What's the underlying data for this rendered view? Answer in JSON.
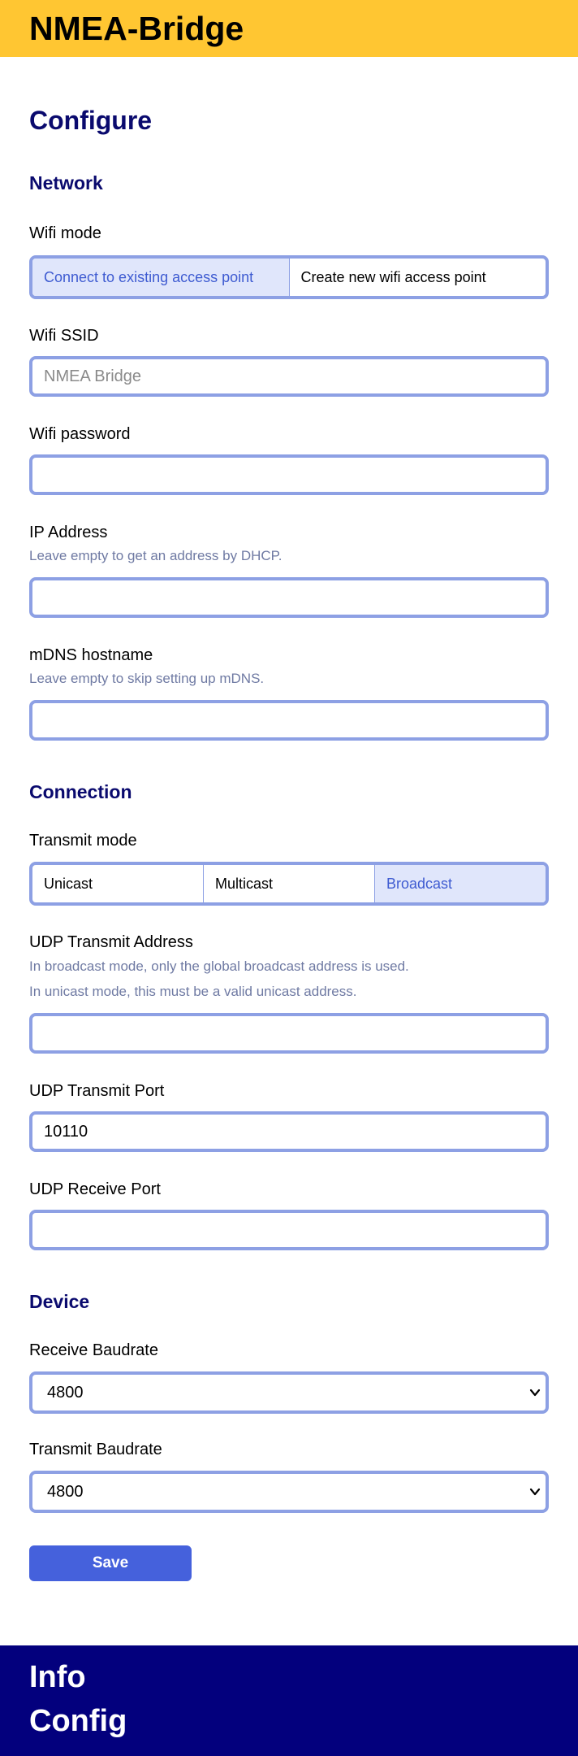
{
  "header": {
    "title": "NMEA-Bridge"
  },
  "page": {
    "title": "Configure"
  },
  "network": {
    "title": "Network",
    "wifi_mode": {
      "label": "Wifi mode",
      "options": [
        "Connect to existing access point",
        "Create new wifi access point"
      ],
      "selected": "Connect to existing access point"
    },
    "ssid": {
      "label": "Wifi SSID",
      "value": "",
      "placeholder": "NMEA Bridge"
    },
    "password": {
      "label": "Wifi password",
      "value": ""
    },
    "ip": {
      "label": "IP Address",
      "hint": "Leave empty to get an address by DHCP.",
      "value": ""
    },
    "mdns": {
      "label": "mDNS hostname",
      "hint": "Leave empty to skip setting up mDNS.",
      "value": ""
    }
  },
  "connection": {
    "title": "Connection",
    "transmit_mode": {
      "label": "Transmit mode",
      "options": [
        "Unicast",
        "Multicast",
        "Broadcast"
      ],
      "selected": "Broadcast"
    },
    "udp_address": {
      "label": "UDP Transmit Address",
      "hint1": "In broadcast mode, only the global broadcast address is used.",
      "hint2": "In unicast mode, this must be a valid unicast address.",
      "value": ""
    },
    "udp_transmit_port": {
      "label": "UDP Transmit Port",
      "value": "10110"
    },
    "udp_receive_port": {
      "label": "UDP Receive Port",
      "value": ""
    }
  },
  "device": {
    "title": "Device",
    "receive_baudrate": {
      "label": "Receive Baudrate",
      "value": "4800"
    },
    "transmit_baudrate": {
      "label": "Transmit Baudrate",
      "value": "4800"
    }
  },
  "actions": {
    "save_label": "Save"
  },
  "footer": {
    "links": [
      "Info",
      "Config"
    ]
  },
  "colors": {
    "header_bg": "#ffc632",
    "heading": "#0a0a6e",
    "field_border": "#8da0e4",
    "active_option_bg": "#e0e6fb",
    "active_option_text": "#3e5bd1",
    "button_bg": "#4561dc",
    "footer_bg": "#03007d"
  },
  "icons": {
    "select_arrow": "chevron-down-icon"
  }
}
